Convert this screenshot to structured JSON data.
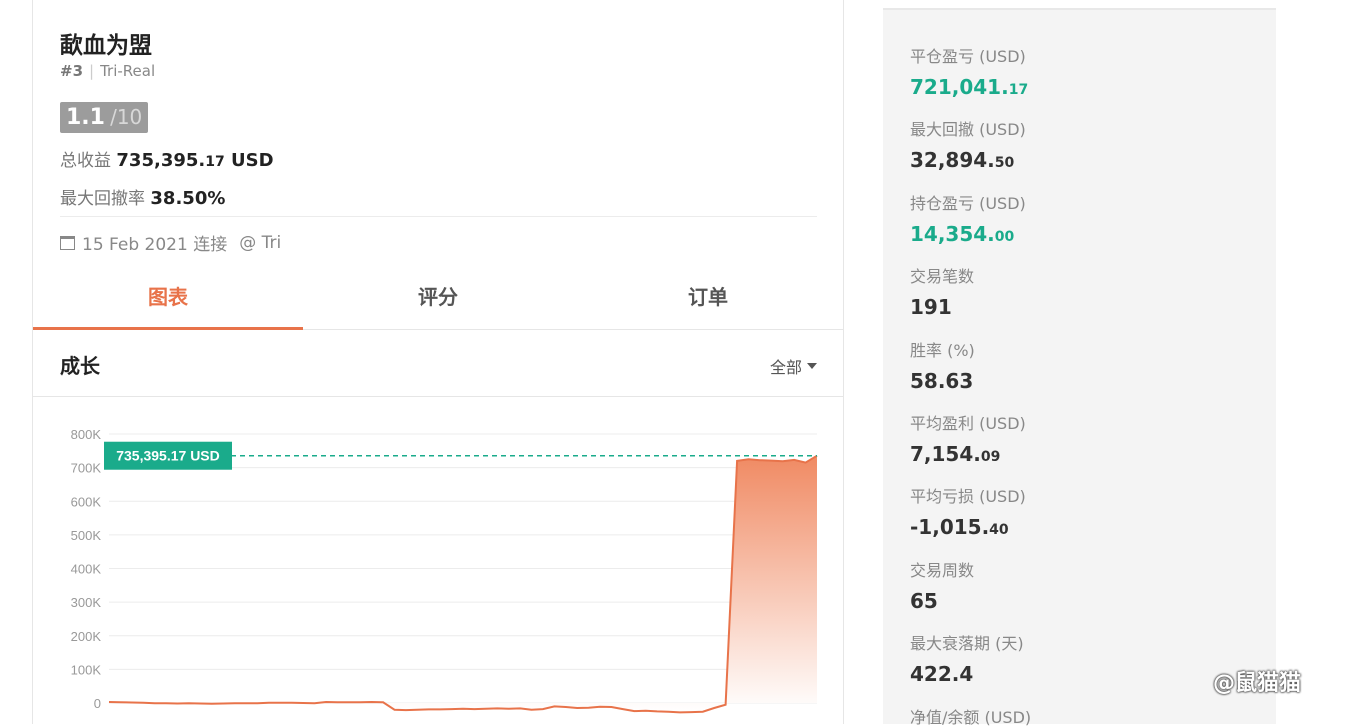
{
  "header": {
    "title": "歃血为盟",
    "rank": "#3",
    "broker": "Tri-Real",
    "score_main": "1.1",
    "score_max": "/10",
    "total_gain_label": "总收益",
    "total_gain_int": "735,395.",
    "total_gain_dec": "17",
    "total_gain_unit": "USD",
    "max_dd_label": "最大回撤率",
    "max_dd_value": "38.50%",
    "connected_text": "15 Feb 2021 连接",
    "connected_via": "@ Tri"
  },
  "tabs": [
    {
      "label": "图表",
      "active": true
    },
    {
      "label": "评分",
      "active": false
    },
    {
      "label": "订单",
      "active": false
    }
  ],
  "section": {
    "title": "成长",
    "range_label": "全部"
  },
  "chart_data": {
    "type": "area",
    "title": "",
    "ylim": [
      0,
      800000
    ],
    "y_ticks": [
      "800K",
      "700K",
      "600K",
      "500K",
      "400K",
      "300K",
      "200K",
      "100K",
      "0"
    ],
    "current_label": "735,395.17 USD",
    "current_value": 735395.17,
    "series": [
      {
        "values": [
          3000,
          2500,
          1500,
          1000,
          -500,
          -1000,
          -1500,
          -1000,
          -1500,
          -2000,
          -1500,
          -1000,
          -500,
          -500,
          500,
          1000,
          500,
          0,
          -500,
          3000,
          2500,
          2000,
          2000,
          3000,
          2000,
          -20000,
          -21000,
          -20000,
          -19000,
          -19000,
          -18000,
          -17000,
          -18000,
          -17000,
          -16000,
          -17000,
          -16000,
          -20000,
          -18000,
          -10000,
          -12000,
          -15000,
          -14000,
          -11000,
          -12000,
          -18000,
          -24000,
          -23000,
          -25000,
          -26000,
          -28000,
          -27000,
          -26000,
          -15000,
          -5000,
          720000,
          725000,
          722000,
          721000,
          719000,
          723000,
          715000,
          735395
        ]
      }
    ],
    "colors": {
      "line": "#e8734a",
      "fill_top": "#f08a63",
      "fill_bottom": "#ffffff",
      "label_bg": "#1aab8b",
      "dash": "#1aab8b"
    }
  },
  "stats": [
    {
      "label": "平仓盈亏 (USD)",
      "int": "721,041.",
      "dec": "17",
      "green": true
    },
    {
      "label": "最大回撤 (USD)",
      "int": "32,894.",
      "dec": "50",
      "green": false
    },
    {
      "label": "持仓盈亏 (USD)",
      "int": "14,354.",
      "dec": "00",
      "green": true
    },
    {
      "label": "交易笔数",
      "int": "191",
      "dec": "",
      "green": false
    },
    {
      "label": "胜率 (%)",
      "int": "58.63",
      "dec": "",
      "green": false
    },
    {
      "label": "平均盈利 (USD)",
      "int": "7,154.",
      "dec": "09",
      "green": false
    },
    {
      "label": "平均亏损 (USD)",
      "int": "-1,015.",
      "dec": "40",
      "green": false
    },
    {
      "label": "交易周数",
      "int": "65",
      "dec": "",
      "green": false
    },
    {
      "label": "最大衰落期 (天)",
      "int": "422.4",
      "dec": "",
      "green": false
    },
    {
      "label": "净值/余额 (USD)",
      "int": "",
      "dec": "",
      "green": false
    }
  ],
  "watermark": "@鼠猫猫"
}
